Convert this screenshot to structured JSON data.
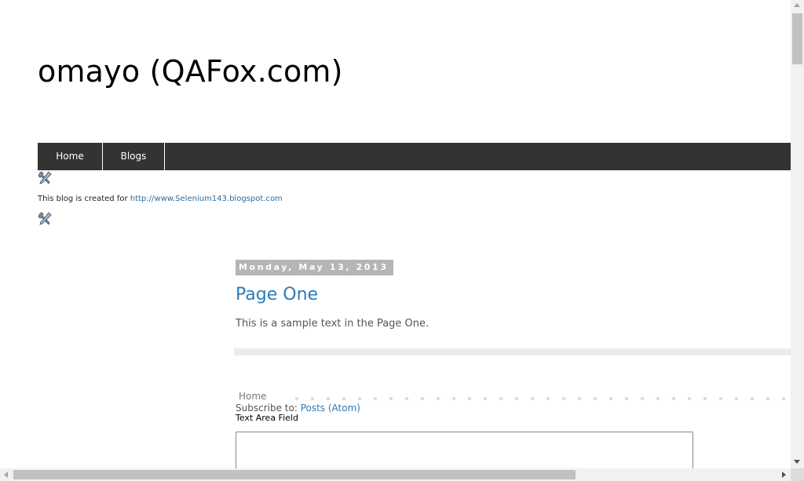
{
  "header": {
    "blog_title": "omayo (QAFox.com)"
  },
  "nav": {
    "items": [
      {
        "label": "Home"
      },
      {
        "label": "Blogs"
      }
    ]
  },
  "widgets": {
    "tool_icon_name": "tools-icon",
    "created_text": "This blog is created for ",
    "created_link": "http://www.Selenium143.blogspot.com"
  },
  "post": {
    "date": "Monday, May 13, 2013",
    "title": "Page One",
    "body": "This is a sample text in the Page One."
  },
  "footer": {
    "home_link": "Home",
    "subscribe_prefix": "Subscribe to: ",
    "subscribe_link": "Posts (Atom)"
  },
  "form": {
    "textarea_label": "Text Area Field",
    "textarea_value": ""
  },
  "colors": {
    "nav_bg": "#333333",
    "link": "#2b7bb9",
    "date_bg": "#b5b5b5"
  }
}
